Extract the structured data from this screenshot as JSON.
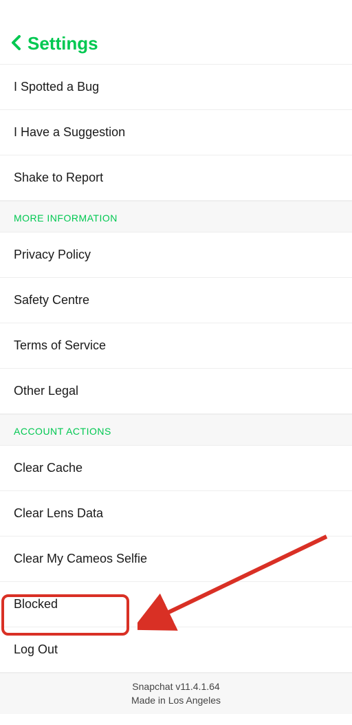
{
  "header": {
    "title": "Settings"
  },
  "sections": {
    "feedback": {
      "items": [
        "I Spotted a Bug",
        "I Have a Suggestion",
        "Shake to Report"
      ]
    },
    "more_information": {
      "title": "MORE INFORMATION",
      "items": [
        "Privacy Policy",
        "Safety Centre",
        "Terms of Service",
        "Other Legal"
      ]
    },
    "account_actions": {
      "title": "ACCOUNT ACTIONS",
      "items": [
        "Clear Cache",
        "Clear Lens Data",
        "Clear My Cameos Selfie",
        "Blocked",
        "Log Out"
      ]
    }
  },
  "footer": {
    "version": "Snapchat v11.4.1.64",
    "location": "Made in Los Angeles"
  },
  "annotation": {
    "highlighted_item": "Blocked",
    "highlight_color": "#d93025"
  }
}
